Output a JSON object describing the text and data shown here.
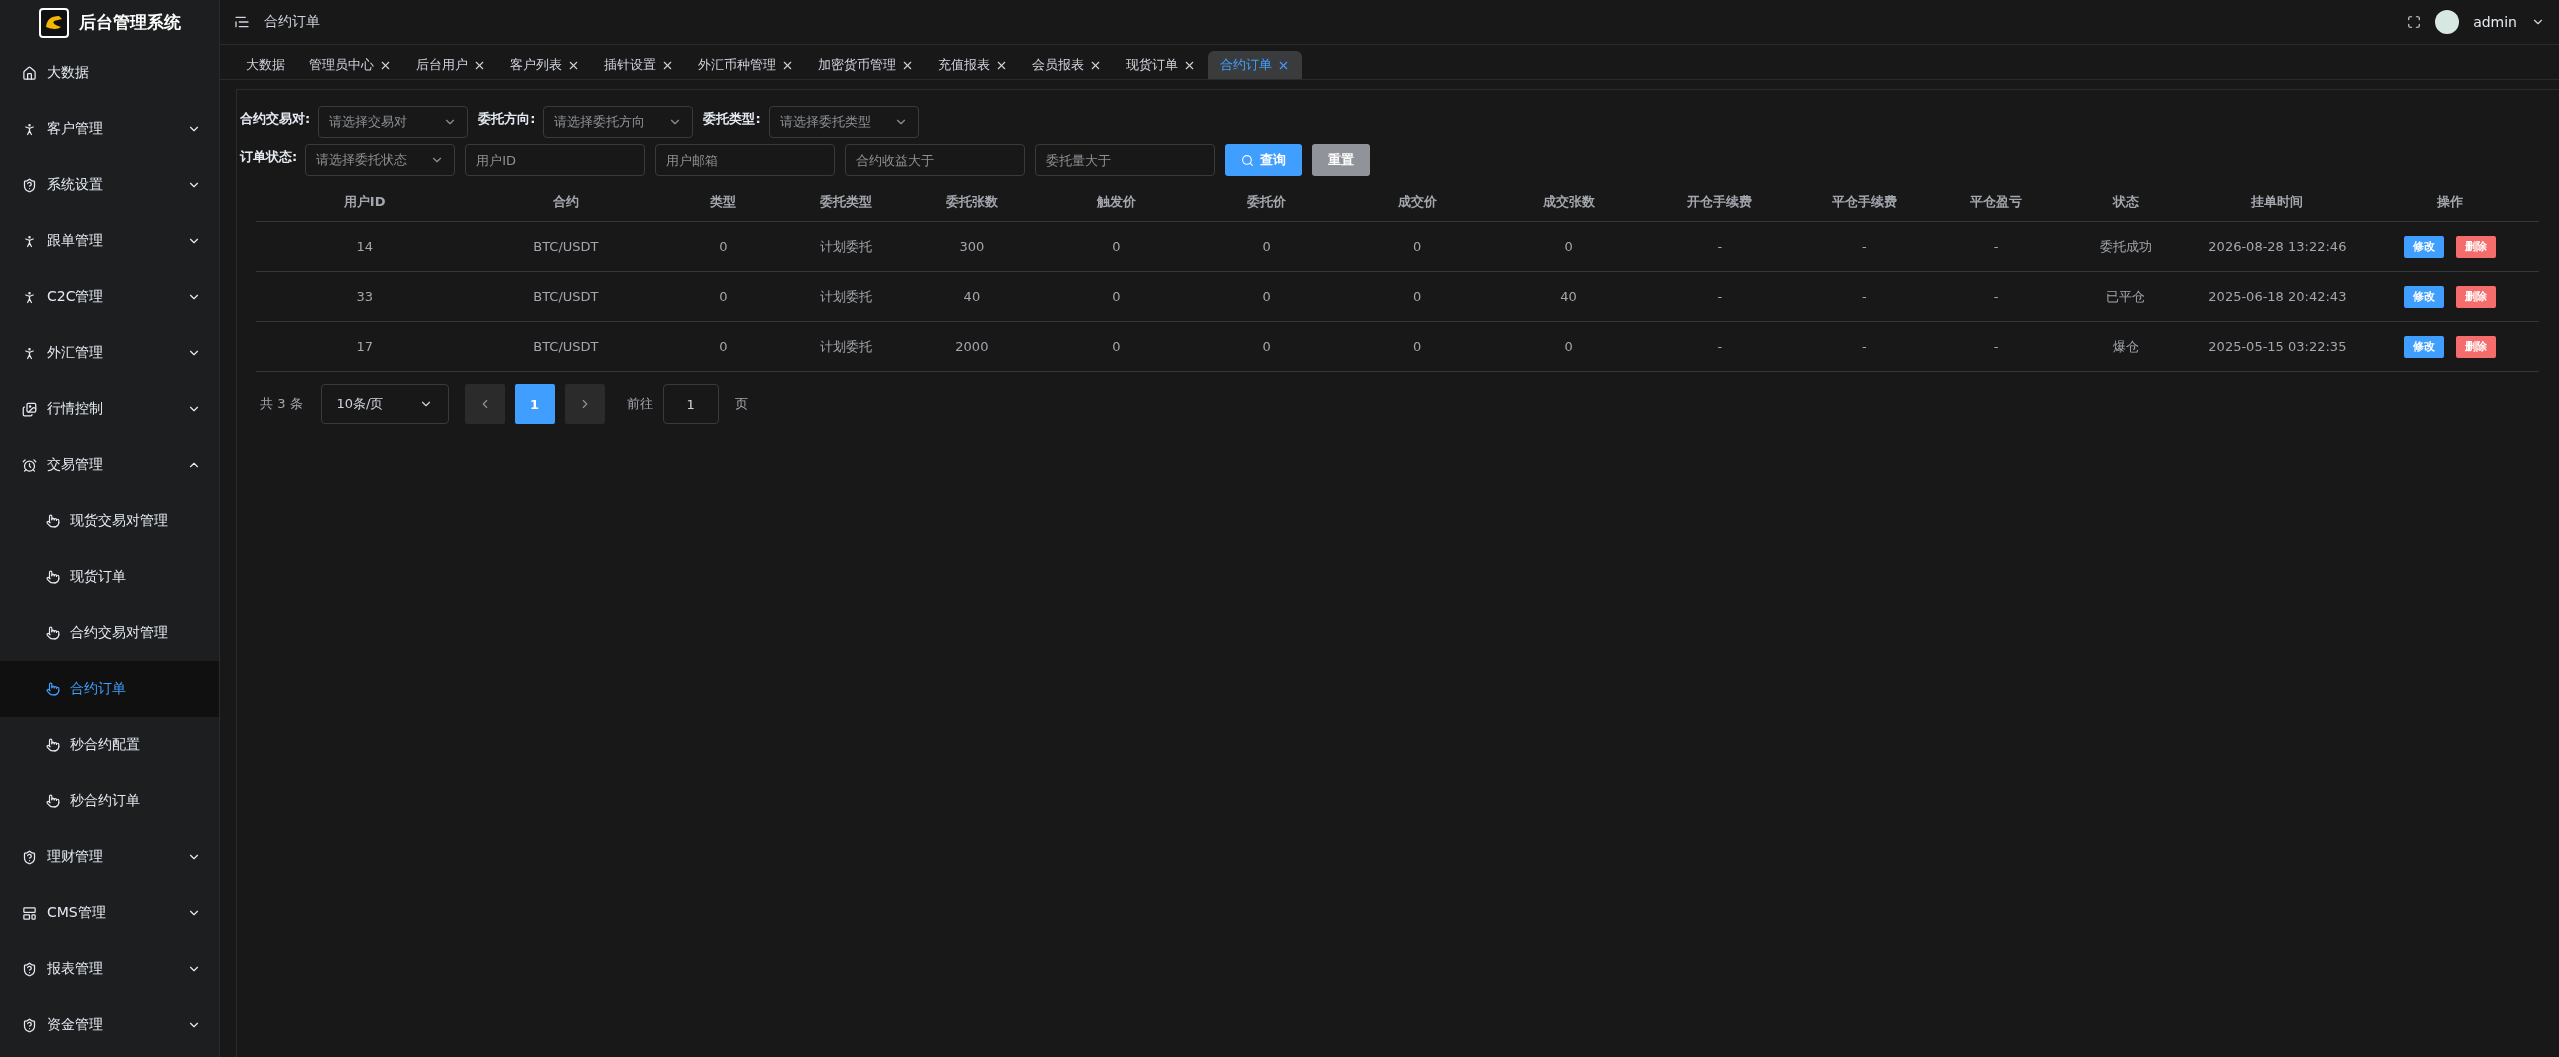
{
  "app": {
    "title": "后台管理系统"
  },
  "sidebar": {
    "items": [
      {
        "label": "大数据",
        "kind": "link",
        "selected": false
      },
      {
        "label": "客户管理",
        "kind": "group",
        "expanded": false,
        "selected": false
      },
      {
        "label": "系统设置",
        "kind": "group",
        "expanded": false,
        "selected": false
      },
      {
        "label": "跟单管理",
        "kind": "group",
        "expanded": false,
        "selected": false
      },
      {
        "label": "C2C管理",
        "kind": "group",
        "expanded": false,
        "selected": false
      },
      {
        "label": "外汇管理",
        "kind": "group",
        "expanded": false,
        "selected": false
      },
      {
        "label": "行情控制",
        "kind": "group",
        "expanded": false,
        "selected": false
      },
      {
        "label": "交易管理",
        "kind": "group",
        "expanded": true,
        "selected": false,
        "children": [
          {
            "label": "现货交易对管理",
            "selected": false
          },
          {
            "label": "现货订单",
            "selected": false
          },
          {
            "label": "合约交易对管理",
            "selected": false
          },
          {
            "label": "合约订单",
            "selected": true
          },
          {
            "label": "秒合约配置",
            "selected": false
          },
          {
            "label": "秒合约订单",
            "selected": false
          }
        ]
      },
      {
        "label": "理财管理",
        "kind": "group",
        "expanded": false,
        "selected": false
      },
      {
        "label": "CMS管理",
        "kind": "group",
        "expanded": false,
        "selected": false
      },
      {
        "label": "报表管理",
        "kind": "group",
        "expanded": false,
        "selected": false
      },
      {
        "label": "资金管理",
        "kind": "group",
        "expanded": false,
        "selected": false
      }
    ]
  },
  "header": {
    "breadcrumb": "合约订单",
    "user": "admin"
  },
  "tabs": [
    {
      "label": "大数据",
      "closable": false,
      "selected": false
    },
    {
      "label": "管理员中心",
      "closable": true,
      "selected": false
    },
    {
      "label": "后台用户",
      "closable": true,
      "selected": false
    },
    {
      "label": "客户列表",
      "closable": true,
      "selected": false
    },
    {
      "label": "插针设置",
      "closable": true,
      "selected": false
    },
    {
      "label": "外汇币种管理",
      "closable": true,
      "selected": false
    },
    {
      "label": "加密货币管理",
      "closable": true,
      "selected": false
    },
    {
      "label": "充值报表",
      "closable": true,
      "selected": false
    },
    {
      "label": "会员报表",
      "closable": true,
      "selected": false
    },
    {
      "label": "现货订单",
      "closable": true,
      "selected": false
    },
    {
      "label": "合约订单",
      "closable": true,
      "selected": true
    }
  ],
  "filters": {
    "rows": [
      [
        {
          "kind": "select",
          "label": "合约交易对:",
          "placeholder": "请选择交易对"
        },
        {
          "kind": "select",
          "label": "委托方向:",
          "placeholder": "请选择委托方向"
        },
        {
          "kind": "select",
          "label": "委托类型:",
          "placeholder": "请选择委托类型"
        }
      ],
      [
        {
          "kind": "select",
          "label": "订单状态:",
          "placeholder": "请选择委托状态"
        },
        {
          "kind": "input",
          "placeholder": "用户ID"
        },
        {
          "kind": "input",
          "placeholder": "用户邮箱"
        },
        {
          "kind": "input",
          "placeholder": "合约收益大于"
        },
        {
          "kind": "input",
          "placeholder": "委托量大于"
        },
        {
          "kind": "search",
          "label": "查询"
        },
        {
          "kind": "reset",
          "label": "重置"
        }
      ]
    ]
  },
  "table": {
    "columns": [
      "用户ID",
      "合约",
      "类型",
      "委托类型",
      "委托张数",
      "触发价",
      "委托价",
      "成交价",
      "成交张数",
      "开仓手续费",
      "平仓手续费",
      "平仓盈亏",
      "状态",
      "挂单时间",
      "操作"
    ],
    "rows": [
      {
        "cells": [
          "14",
          "BTC/USDT",
          "0",
          "计划委托",
          "300",
          "0",
          "0",
          "0",
          "0",
          "-",
          "-",
          "-",
          "委托成功",
          "2026-08-28 13:22:46"
        ],
        "actions": [
          {
            "kind": "edit",
            "label": "修改"
          },
          {
            "kind": "delete",
            "label": "删除"
          }
        ]
      },
      {
        "cells": [
          "33",
          "BTC/USDT",
          "0",
          "计划委托",
          "40",
          "0",
          "0",
          "0",
          "40",
          "-",
          "-",
          "-",
          "已平仓",
          "2025-06-18 20:42:43"
        ],
        "actions": [
          {
            "kind": "edit",
            "label": "修改"
          },
          {
            "kind": "delete",
            "label": "删除"
          }
        ]
      },
      {
        "cells": [
          "17",
          "BTC/USDT",
          "0",
          "计划委托",
          "2000",
          "0",
          "0",
          "0",
          "0",
          "-",
          "-",
          "-",
          "爆仓",
          "2025-05-15 03:22:35"
        ],
        "actions": [
          {
            "kind": "edit",
            "label": "修改"
          },
          {
            "kind": "delete",
            "label": "删除"
          }
        ]
      }
    ]
  },
  "pagination": {
    "total": "共 3 条",
    "page_size": "10条/页",
    "pages": [
      {
        "label": "1",
        "selected": true
      }
    ],
    "goto_label": "前往",
    "goto_value": "1",
    "page_unit": "页"
  }
}
